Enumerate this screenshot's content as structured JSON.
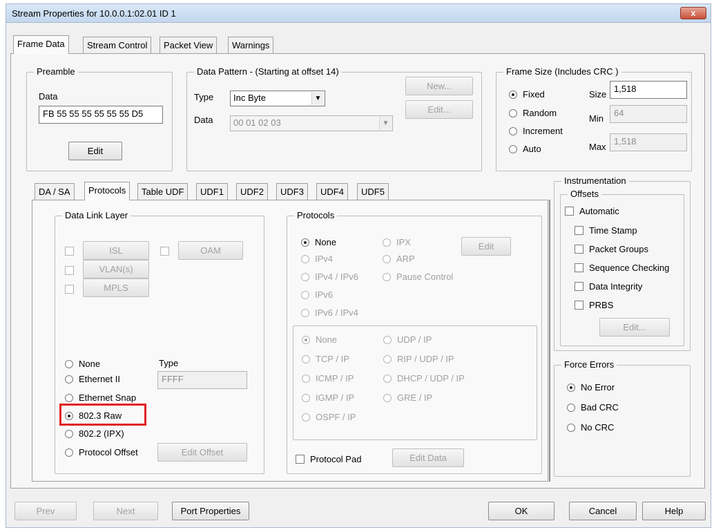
{
  "window": {
    "title": "Stream Properties for 10.0.0.1:02.01  ID 1",
    "close_label": "x"
  },
  "main_tabs": [
    "Frame Data",
    "Stream Control",
    "Packet View",
    "Warnings"
  ],
  "preamble": {
    "title": "Preamble",
    "data_label": "Data",
    "data_value": "FB 55 55 55 55 55 55 D5",
    "edit_label": "Edit"
  },
  "data_pattern": {
    "title": "Data Pattern - (Starting at offset 14)",
    "type_label": "Type",
    "type_value": "Inc Byte",
    "data_label": "Data",
    "data_value": "00 01 02 03",
    "new_label": "New...",
    "edit_label": "Edit..."
  },
  "frame_size": {
    "title": "Frame Size  (Includes CRC )",
    "options": [
      "Fixed",
      "Random",
      "Increment",
      "Auto"
    ],
    "selected": "Fixed",
    "size_label": "Size",
    "size_value": "1,518",
    "min_label": "Min",
    "min_value": "64",
    "max_label": "Max",
    "max_value": "1,518"
  },
  "sub_tabs": [
    "DA / SA",
    "Protocols",
    "Table UDF",
    "UDF1",
    "UDF2",
    "UDF3",
    "UDF4",
    "UDF5"
  ],
  "data_link": {
    "title": "Data Link Layer",
    "buttons": [
      "ISL",
      "OAM",
      "VLAN(s)",
      "MPLS"
    ],
    "options": [
      "None",
      "Ethernet II",
      "Ethernet Snap",
      "802.3 Raw",
      "802.2 (IPX)",
      "Protocol Offset"
    ],
    "selected": "802.3 Raw",
    "type_label": "Type",
    "type_value": "FFFF",
    "edit_offset_label": "Edit Offset"
  },
  "protocols": {
    "title": "Protocols",
    "l3_options": [
      "None",
      "IPX",
      "IPv4",
      "ARP",
      "IPv4 / IPv6",
      "Pause Control",
      "IPv6",
      "IPv6 / IPv4"
    ],
    "l3_selected": "None",
    "edit_label": "Edit",
    "l4_options": [
      "None",
      "UDP / IP",
      "TCP / IP",
      "RIP / UDP / IP",
      "ICMP / IP",
      "DHCP / UDP / IP",
      "IGMP / IP",
      "GRE / IP",
      "OSPF / IP"
    ],
    "l4_selected": "None",
    "pad_label": "Protocol Pad",
    "edit_data_label": "Edit Data"
  },
  "instrumentation": {
    "title": "Instrumentation",
    "offsets_title": "Offsets",
    "automatic_label": "Automatic",
    "items": [
      "Time Stamp",
      "Packet Groups",
      "Sequence Checking",
      "Data Integrity",
      "PRBS"
    ],
    "edit_label": "Edit..."
  },
  "force_errors": {
    "title": "Force Errors",
    "options": [
      "No Error",
      "Bad CRC",
      "No CRC"
    ],
    "selected": "No Error"
  },
  "footer": {
    "prev": "Prev",
    "next": "Next",
    "port_properties": "Port Properties",
    "ok": "OK",
    "cancel": "Cancel",
    "help": "Help"
  }
}
